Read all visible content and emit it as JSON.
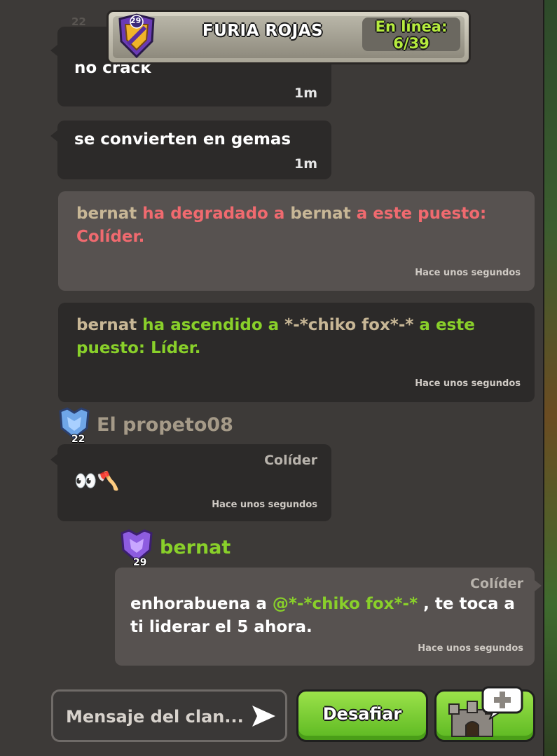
{
  "header": {
    "clan_level": "29",
    "clan_name": "FURIA ROJAS",
    "online_label": "En línea:",
    "online_count": "6/39"
  },
  "messages": [
    {
      "type": "text",
      "level": "22",
      "text": "no crack",
      "time": "1m"
    },
    {
      "type": "text",
      "text": "se convierten en gemas",
      "time": "1m"
    },
    {
      "type": "system",
      "parts": [
        {
          "text": "bernat",
          "color": "beige"
        },
        {
          "text": " ha degradado a ",
          "color": "red"
        },
        {
          "text": "bernat",
          "color": "beige"
        },
        {
          "text": " a este puesto: Colíder.",
          "color": "red"
        }
      ],
      "time": "Hace unos segundos"
    },
    {
      "type": "system",
      "parts": [
        {
          "text": "bernat",
          "color": "beige"
        },
        {
          "text": " ha ascendido a ",
          "color": "green"
        },
        {
          "text": "*-*chiko fox*-*",
          "color": "beige"
        },
        {
          "text": " a este puesto: Líder.",
          "color": "green"
        }
      ],
      "time": "Hace unos segundos"
    },
    {
      "type": "member",
      "name": "El propeto08",
      "level": "22",
      "role": "Colíder",
      "text": "👀🪓",
      "time": "Hace unos segundos"
    },
    {
      "type": "member",
      "name": "bernat",
      "level": "29",
      "role": "Colíder",
      "text_before": "enhorabuena a ",
      "mention": "@*-*chiko fox*-*",
      "text_after": " , te toca a ti liderar el 5 ahora.",
      "time": "Hace unos segundos"
    }
  ],
  "input": {
    "placeholder": "Mensaje del clan..."
  },
  "buttons": {
    "challenge": "Desafiar"
  },
  "icons": {
    "send": "send-arrow-icon",
    "castle": "clan-castle-icon",
    "add_chat": "chat-plus-icon"
  },
  "colors": {
    "panel": "#3d3a38",
    "bubble": "#2c2a29",
    "system_bubble": "#575250",
    "green": "#89d02a",
    "red": "#f06a6f",
    "beige": "#c8b796"
  }
}
